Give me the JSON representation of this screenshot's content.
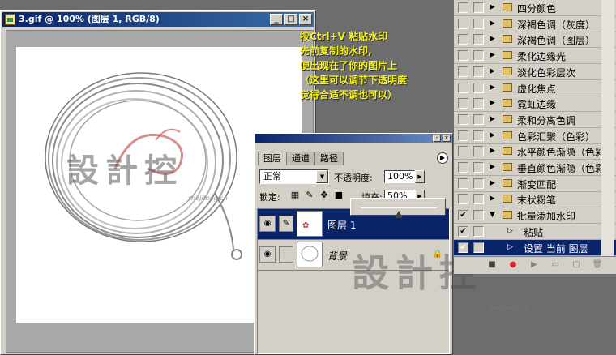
{
  "document": {
    "title": "3.gif @ 100% (图层 1, RGB/8)",
    "watermark_text": "設計控",
    "watermark_url": "shejitong.cn"
  },
  "annotation": {
    "lines": [
      "按Ctrl+V 粘贴水印",
      "先前复制的水印,",
      "便出现在了你的图片上",
      "（这里可以调节下透明度",
      "觉得合适不调也可以）"
    ]
  },
  "layers_panel": {
    "tabs": [
      "图层",
      "通道",
      "路径"
    ],
    "blend_mode": "正常",
    "opacity_label": "不透明度:",
    "opacity_value": "100%",
    "lock_label": "锁定:",
    "fill_label": "填充:",
    "fill_value": "50%",
    "fill_level": 0.5,
    "layers": [
      {
        "name": "图层 1",
        "selected": true
      },
      {
        "name": "背景",
        "selected": false,
        "locked": true
      }
    ]
  },
  "actions_panel": {
    "items": [
      {
        "label": "四分颜色",
        "checked": false,
        "level": 0
      },
      {
        "label": "深褐色调（灰度）",
        "checked": false,
        "level": 0
      },
      {
        "label": "深褐色调（图层）",
        "checked": false,
        "level": 0
      },
      {
        "label": "柔化边缘光",
        "checked": false,
        "level": 0
      },
      {
        "label": "淡化色彩层次",
        "checked": false,
        "level": 0
      },
      {
        "label": "虚化焦点",
        "checked": false,
        "level": 0
      },
      {
        "label": "霓虹边缘",
        "checked": false,
        "level": 0
      },
      {
        "label": "柔和分离色调",
        "checked": false,
        "level": 0
      },
      {
        "label": "色彩汇聚（色彩）",
        "checked": false,
        "level": 0
      },
      {
        "label": "水平颜色渐隐（色彩）",
        "checked": false,
        "level": 0
      },
      {
        "label": "垂直颜色渐隐（色彩）",
        "checked": false,
        "level": 0
      },
      {
        "label": "渐变匹配",
        "checked": false,
        "level": 0
      },
      {
        "label": "末状粉笔",
        "checked": false,
        "level": 0
      },
      {
        "label": "批量添加水印",
        "checked": true,
        "level": 0,
        "expanded": true
      },
      {
        "label": "粘贴",
        "checked": true,
        "level": 1
      },
      {
        "label": "设置 当前 图层",
        "checked": true,
        "level": 1,
        "selected": true
      }
    ]
  },
  "colors": {
    "titlebar": "#0a246a",
    "annotation_text": "#f5f020",
    "panel_bg": "#d4d0c8",
    "selection": "#0a246a"
  }
}
